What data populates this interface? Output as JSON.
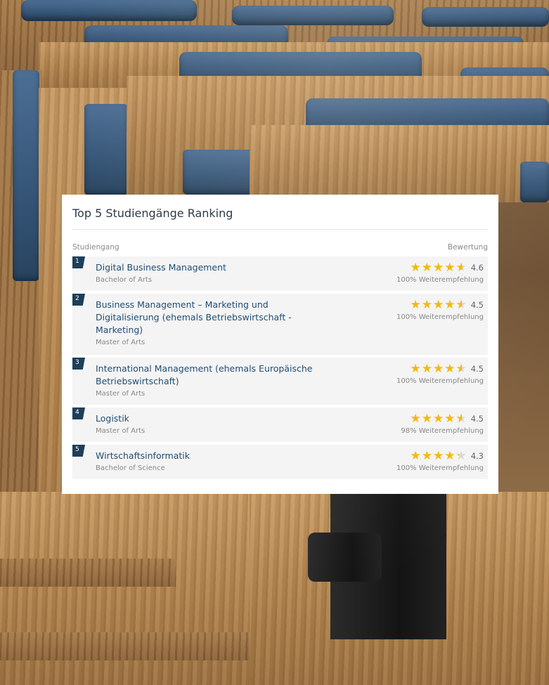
{
  "card": {
    "title": "Top 5 Studiengänge Ranking",
    "column_left": "Studiengang",
    "column_right": "Bewertung"
  },
  "ranking": [
    {
      "rank": "1",
      "name": "Digital Business Management",
      "degree": "Bachelor of Arts",
      "score": "4.6",
      "rating": 4.6,
      "recommendation": "100% Weiterempfehlung"
    },
    {
      "rank": "2",
      "name": "Business Management – Marketing und Digitalisierung (ehemals Betriebswirtschaft - Marketing)",
      "degree": "Master of Arts",
      "score": "4.5",
      "rating": 4.5,
      "recommendation": "100% Weiterempfehlung"
    },
    {
      "rank": "3",
      "name": "International Management (ehemals Europäische Betriebswirtschaft)",
      "degree": "Master of Arts",
      "score": "4.5",
      "rating": 4.5,
      "recommendation": "100% Weiterempfehlung"
    },
    {
      "rank": "4",
      "name": "Logistik",
      "degree": "Master of Arts",
      "score": "4.5",
      "rating": 4.5,
      "recommendation": "98% Weiterempfehlung"
    },
    {
      "rank": "5",
      "name": "Wirtschaftsinformatik",
      "degree": "Bachelor of Science",
      "score": "4.3",
      "rating": 4.3,
      "recommendation": "100% Weiterempfehlung"
    }
  ],
  "colors": {
    "accent": "#1f4d73",
    "rank_badge": "#1d3f5a",
    "star": "#f5b90b",
    "star_empty": "#d9d9d9"
  },
  "icons": {
    "star": "star-icon"
  }
}
